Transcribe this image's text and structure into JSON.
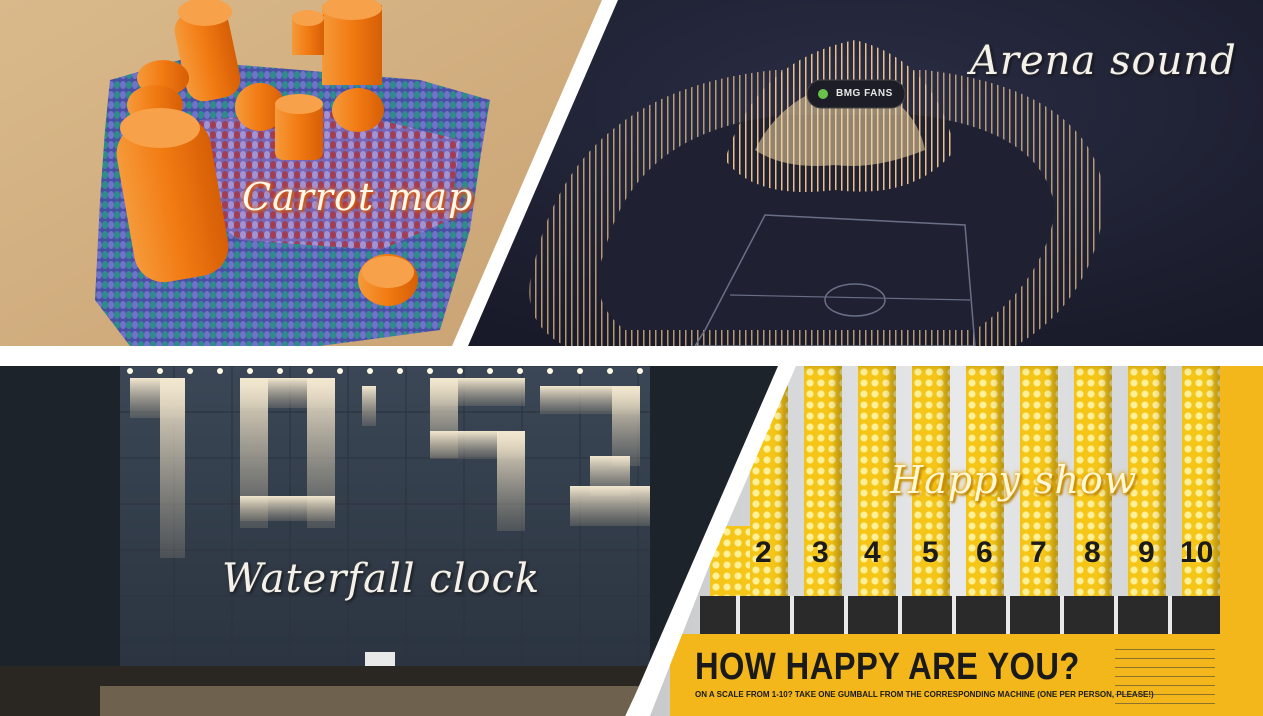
{
  "panels": {
    "carrot_map": {
      "caption": "Carrot map"
    },
    "arena_sound": {
      "caption": "Arena sound",
      "badge": "BMG FANS"
    },
    "waterfall_clock": {
      "caption": "Waterfall clock",
      "digits": "10:52"
    },
    "happy_show": {
      "caption": "Happy show",
      "tube_numbers": [
        "2",
        "3",
        "4",
        "5",
        "6",
        "7",
        "8",
        "9",
        "10"
      ],
      "headline": "HOW HAPPY ARE YOU?",
      "subline": "ON A SCALE FROM 1-10? TAKE ONE GUMBALL FROM THE CORRESPONDING MACHINE (ONE PER PERSON, PLEASE!)"
    }
  },
  "colors": {
    "divider": "#ffffff",
    "carrot": "#f07a1a",
    "arena_bg": "#1f2133",
    "arena_dots": "#e8c08a",
    "clock_bg": "#3a4654",
    "gumball": "#f5c518",
    "board": "#f3b71b"
  }
}
